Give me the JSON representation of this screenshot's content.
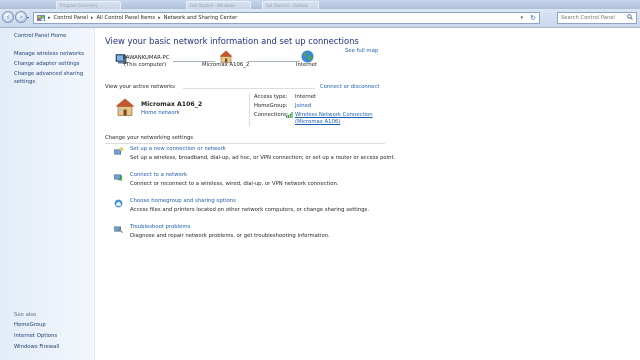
{
  "titlebar": {
    "ghost_tabs": [
      "Program Summary",
      "Get Started - Windows",
      "Set Started - Outlook"
    ]
  },
  "nav": {
    "back_label": "‹",
    "forward_label": "›",
    "breadcrumbs": [
      "Control Panel",
      "All Control Panel Items",
      "Network and Sharing Center"
    ],
    "search_placeholder": "Search Control Panel"
  },
  "sidebar": {
    "top_links": [
      "Control Panel Home",
      "Manage wireless networks",
      "Change adapter settings",
      "Change advanced sharing",
      "settings"
    ],
    "see_also_heading": "See also",
    "see_also": [
      "HomeGroup",
      "Internet Options",
      "Windows Firewall"
    ]
  },
  "main": {
    "heading": "View your basic network information and set up connections",
    "see_full_map": "See full map",
    "map": {
      "computer_name": "PAWANKUMAR-PC",
      "computer_sub": "(This computer)",
      "network_name": "Micromax A106_2",
      "internet_label": "Internet"
    },
    "active_label": "View your active networks",
    "connect_or_disconnect": "Connect or disconnect",
    "active": {
      "name": "Micromax A106_2",
      "type": "Home network",
      "access_type_label": "Access type:",
      "access_type_value": "Internet",
      "homegroup_label": "HomeGroup:",
      "homegroup_value": "Joined",
      "connections_label": "Connections:",
      "connections_value_1": "Wireless Network Connection",
      "connections_value_2": "(Micromax A106)"
    },
    "change_label": "Change your networking settings",
    "tasks": [
      {
        "title": "Set up a new connection or network",
        "desc": "Set up a wireless, broadband, dial-up, ad hoc, or VPN connection; or set up a router or access point."
      },
      {
        "title": "Connect to a network",
        "desc": "Connect or reconnect to a wireless, wired, dial-up, or VPN network connection."
      },
      {
        "title": "Choose homegroup and sharing options",
        "desc": "Access files and printers located on other network computers, or change sharing settings."
      },
      {
        "title": "Troubleshoot problems",
        "desc": "Diagnose and repair network problems, or get troubleshooting information."
      }
    ]
  },
  "icons": {
    "computer": "computer-icon",
    "house": "house-icon",
    "globe": "globe-icon",
    "signal": "signal-bars-icon"
  },
  "colors": {
    "link": "#1a5bb3",
    "heading": "#1e3287",
    "sidebar": "#e3ecf7"
  }
}
